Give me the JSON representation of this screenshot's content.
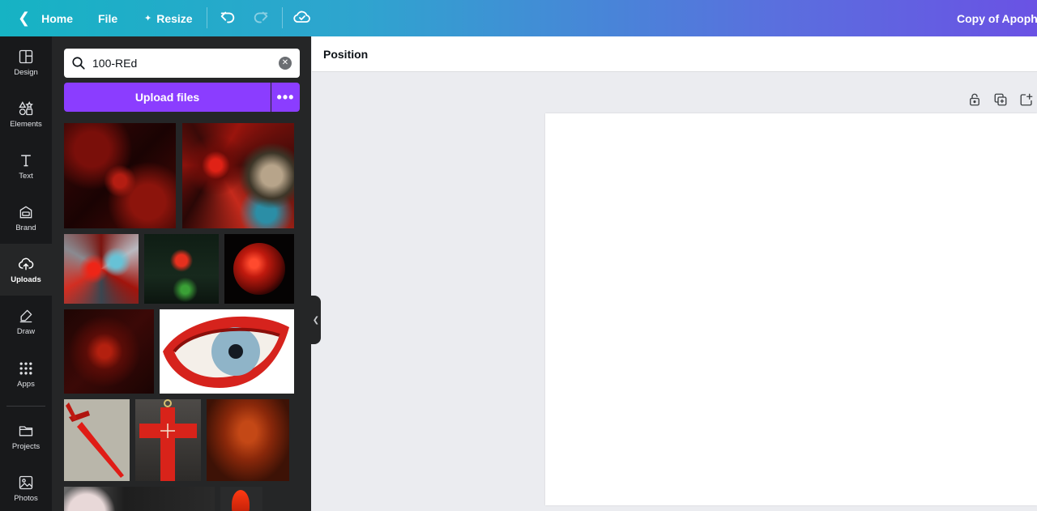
{
  "topbar": {
    "home_label": "Home",
    "file_label": "File",
    "resize_label": "Resize",
    "doc_title": "Copy of Apophys"
  },
  "rail": {
    "items": [
      {
        "label": "Design",
        "icon": "layout-icon"
      },
      {
        "label": "Elements",
        "icon": "shapes-icon"
      },
      {
        "label": "Text",
        "icon": "text-icon"
      },
      {
        "label": "Brand",
        "icon": "brand-icon"
      },
      {
        "label": "Uploads",
        "icon": "cloud-upload-icon",
        "active": true
      },
      {
        "label": "Draw",
        "icon": "pen-icon"
      },
      {
        "label": "Apps",
        "icon": "apps-grid-icon"
      },
      {
        "label": "Projects",
        "icon": "folder-icon"
      },
      {
        "label": "Photos",
        "icon": "image-icon"
      }
    ]
  },
  "panel": {
    "search_value": "100-REd",
    "upload_label": "Upload files"
  },
  "toolbar": {
    "position_label": "Position"
  },
  "colors": {
    "accent": "#8b3dff",
    "rail_bg": "#18191b",
    "panel_bg": "#252627",
    "workspace_bg": "#ebecf0"
  }
}
